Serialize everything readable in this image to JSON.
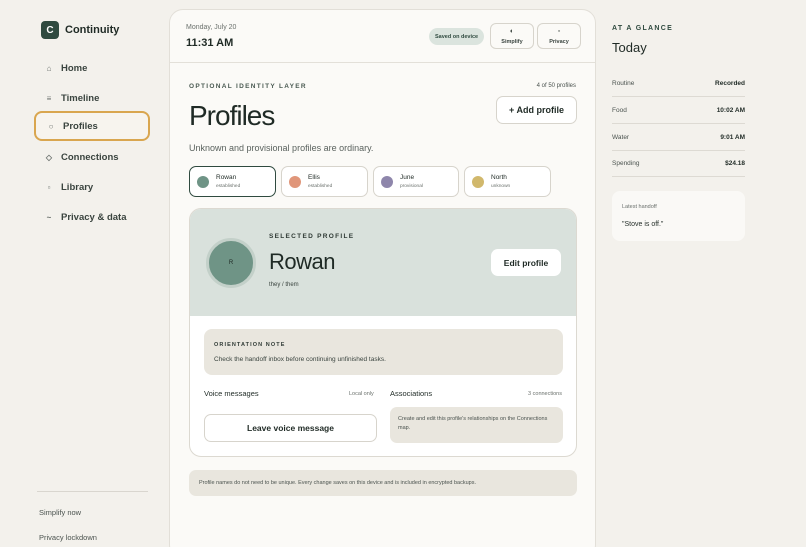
{
  "app": {
    "logo_letter": "C",
    "name": "Continuity"
  },
  "sidebar": {
    "items": [
      {
        "icon": "home-icon",
        "glyph": "⌂",
        "label": "Home"
      },
      {
        "icon": "timeline-icon",
        "glyph": "≡",
        "label": "Timeline"
      },
      {
        "icon": "profiles-icon",
        "glyph": "○",
        "label": "Profiles",
        "active": true
      },
      {
        "icon": "connections-icon",
        "glyph": "◇",
        "label": "Connections"
      },
      {
        "icon": "library-icon",
        "glyph": "▫",
        "label": "Library"
      },
      {
        "icon": "privacy-icon",
        "glyph": "~",
        "label": "Privacy & data"
      }
    ],
    "footer_links": [
      "Simplify now",
      "Privacy lockdown"
    ]
  },
  "header": {
    "date": "Monday, July 20",
    "time": "11:31 AM",
    "saved_badge": "Saved on device",
    "simplify": {
      "glyph": "◐",
      "label": "Simplify"
    },
    "privacy": {
      "glyph": "▫",
      "label": "Privacy"
    }
  },
  "main": {
    "eyebrow": "OPTIONAL IDENTITY LAYER",
    "count": "4 of 50 profiles",
    "title": "Profiles",
    "add_button": "+ Add profile",
    "subtitle": "Unknown and provisional profiles are ordinary.",
    "profiles": [
      {
        "name": "Rowan",
        "status": "established",
        "color": "#6f9486",
        "selected": true
      },
      {
        "name": "Ellis",
        "status": "established",
        "color": "#e0967a"
      },
      {
        "name": "June",
        "status": "provisional",
        "color": "#8e86ab"
      },
      {
        "name": "North",
        "status": "unknown",
        "color": "#d1b86c"
      }
    ],
    "selected": {
      "eyebrow": "SELECTED PROFILE",
      "initial": "R",
      "name": "Rowan",
      "pronouns": "they / them",
      "edit_button": "Edit profile"
    },
    "orientation": {
      "title": "ORIENTATION NOTE",
      "body": "Check the handoff inbox before continuing unfinished tasks."
    },
    "voice": {
      "label": "Voice messages",
      "scope": "Local only",
      "button": "Leave voice message"
    },
    "associations": {
      "label": "Associations",
      "count": "3 connections",
      "body": "Create and edit this profile's relationships on the Connections map."
    },
    "footnote": "Profile names do not need to be unique. Every change saves on this device and is included in encrypted backups."
  },
  "glance": {
    "eyebrow": "AT A GLANCE",
    "title": "Today",
    "stats": [
      {
        "label": "Routine",
        "value": "Recorded"
      },
      {
        "label": "Food",
        "value": "10:02 AM"
      },
      {
        "label": "Water",
        "value": "9:01 AM"
      },
      {
        "label": "Spending",
        "value": "$24.18"
      }
    ],
    "handoff": {
      "title": "Latest handoff",
      "body": "\"Stove is off.\""
    }
  },
  "colors": {
    "accent": "#2f4a3f",
    "active_outline": "#d9a64f",
    "background": "#f3f1ec"
  }
}
